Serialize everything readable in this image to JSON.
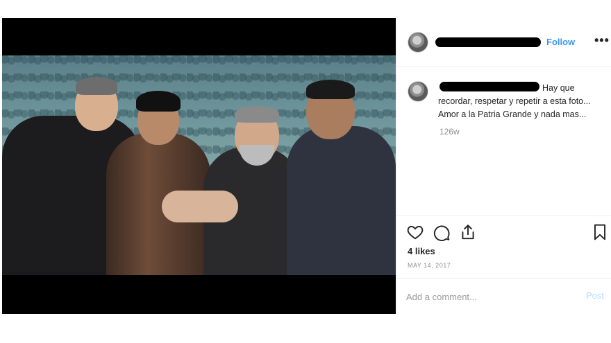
{
  "header": {
    "follow_label": "Follow",
    "more_label": "•••"
  },
  "caption": {
    "text": "Hay que recordar, respetar y repetir a esta foto... Amor a la Patria Grande y nada mas..."
  },
  "time_ago": "126w",
  "likes": "4 likes",
  "date": "MAY 14, 2017",
  "comment": {
    "placeholder": "Add a comment...",
    "post_label": "Post"
  },
  "icons": {
    "like": "heart-icon",
    "comment": "comment-icon",
    "share": "share-icon",
    "save": "bookmark-icon",
    "more": "more-options-icon"
  },
  "colors": {
    "follow": "#3897f0",
    "post_disabled": "#b3dbff",
    "muted": "#8e8e8e"
  }
}
